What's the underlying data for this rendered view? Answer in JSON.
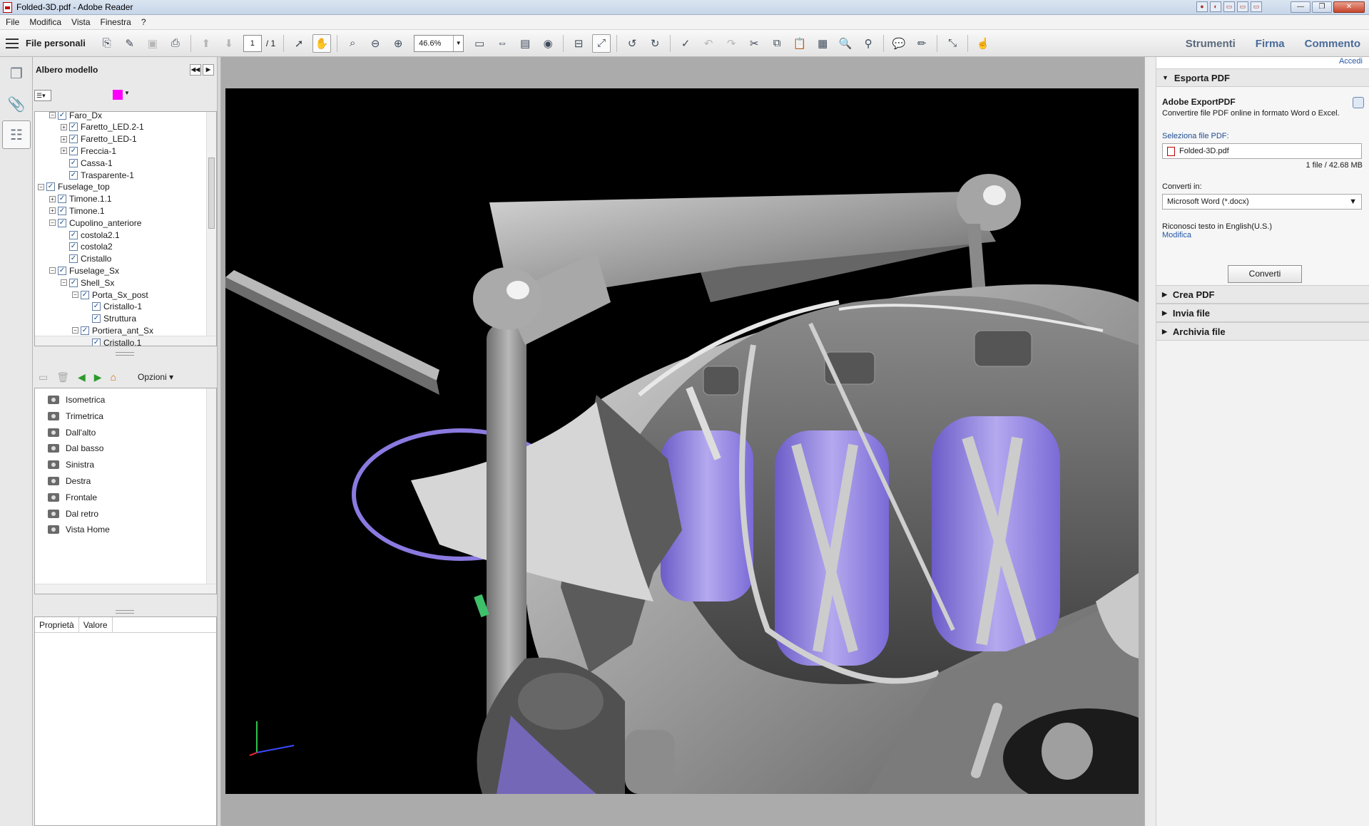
{
  "window": {
    "title": "Folded-3D.pdf - Adobe Reader"
  },
  "menu": [
    "File",
    "Modifica",
    "Vista",
    "Finestra",
    "?"
  ],
  "toolbar": {
    "files_label": "File personali",
    "page_current": "1",
    "page_total": "/ 1",
    "zoom": "46.6%",
    "right_tabs": [
      "Strumenti",
      "Firma",
      "Commento"
    ]
  },
  "model_tree": {
    "title": "Albero modello",
    "items": [
      {
        "label": "Faro_Dx",
        "level": 3,
        "exp": "−"
      },
      {
        "label": "Faretto_LED.2-1",
        "level": 4,
        "exp": "+"
      },
      {
        "label": "Faretto_LED-1",
        "level": 4,
        "exp": "+"
      },
      {
        "label": "Freccia-1",
        "level": 4,
        "exp": "+"
      },
      {
        "label": "Cassa-1",
        "level": 4,
        "exp": ""
      },
      {
        "label": "Trasparente-1",
        "level": 4,
        "exp": ""
      },
      {
        "label": "Fuselage_top",
        "level": 2,
        "exp": "−"
      },
      {
        "label": "Timone.1.1",
        "level": 3,
        "exp": "+"
      },
      {
        "label": "Timone.1",
        "level": 3,
        "exp": "+"
      },
      {
        "label": "Cupolino_anteriore",
        "level": 3,
        "exp": "−"
      },
      {
        "label": "costola2.1",
        "level": 4,
        "exp": ""
      },
      {
        "label": "costola2",
        "level": 4,
        "exp": ""
      },
      {
        "label": "Cristallo",
        "level": 4,
        "exp": ""
      },
      {
        "label": "Fuselage_Sx",
        "level": 3,
        "exp": "−"
      },
      {
        "label": "Shell_Sx",
        "level": 4,
        "exp": "−"
      },
      {
        "label": "Porta_Sx_post",
        "level": 5,
        "exp": "−"
      },
      {
        "label": "Cristallo-1",
        "level": 6,
        "exp": ""
      },
      {
        "label": "Struttura",
        "level": 6,
        "exp": ""
      },
      {
        "label": "Portiera_ant_Sx",
        "level": 5,
        "exp": "−"
      },
      {
        "label": "Cristallo.1",
        "level": 6,
        "exp": ""
      }
    ]
  },
  "views": {
    "options_label": "Opzioni",
    "items": [
      "Isometrica",
      "Trimetrica",
      "Dall'alto",
      "Dal basso",
      "Sinistra",
      "Destra",
      "Frontale",
      "Dal retro",
      "Vista Home"
    ]
  },
  "properties": {
    "headers": [
      "Proprietà",
      "Valore"
    ]
  },
  "right_pane": {
    "signin": "Accedi",
    "export_section": "Esporta PDF",
    "export_title": "Adobe ExportPDF",
    "export_desc": "Convertire file PDF online in formato Word o Excel.",
    "select_label": "Seleziona file PDF:",
    "file_name": "Folded-3D.pdf",
    "file_size": "1 file / 42.68 MB",
    "convert_to_label": "Converti in:",
    "format": "Microsoft Word (*.docx)",
    "ocr_text": "Riconosci testo in English(U.S.)",
    "modify": "Modifica",
    "convert_button": "Converti",
    "sections": [
      "Crea PDF",
      "Invia file",
      "Archivia file"
    ]
  },
  "colors": {
    "seat_accent": "#8a7ae0",
    "canvas_bg": "#000000",
    "swatch": "#ff00ff"
  }
}
